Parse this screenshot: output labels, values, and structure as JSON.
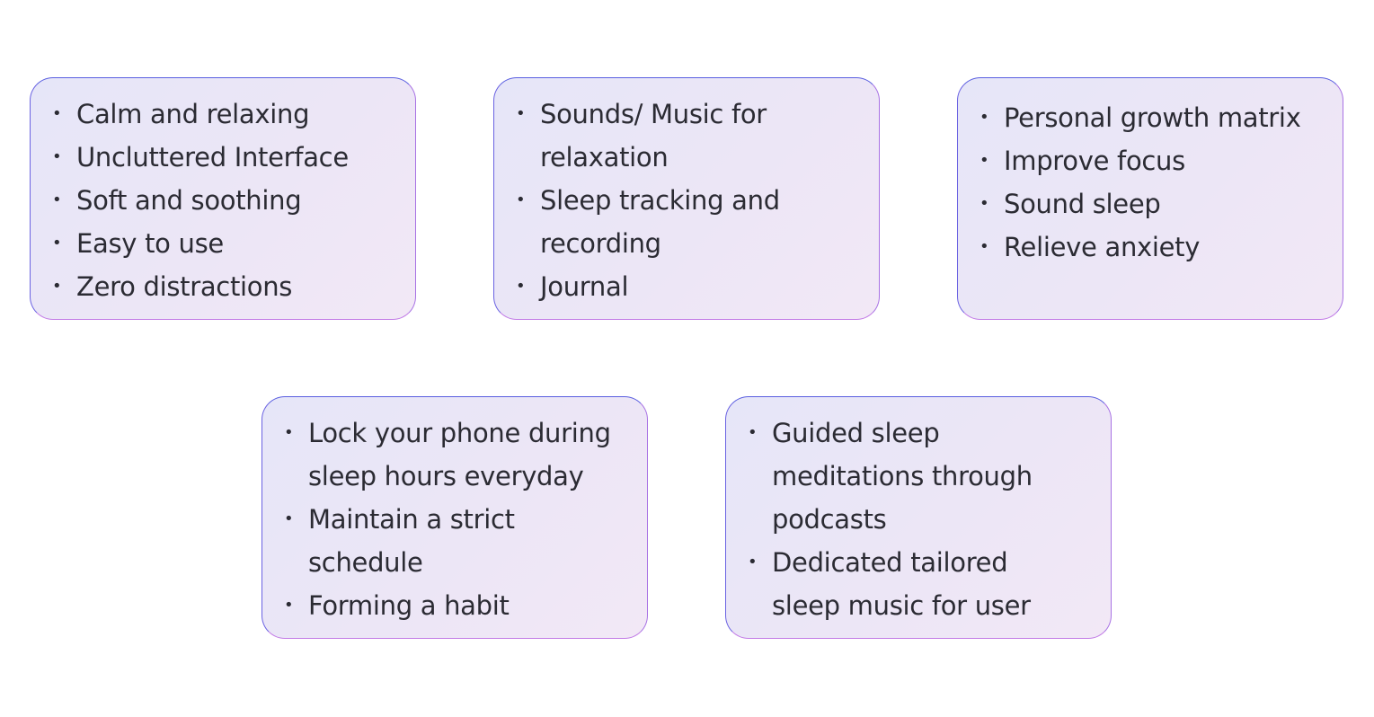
{
  "cards": [
    {
      "items": [
        {
          "lines": [
            "Calm and relaxing"
          ]
        },
        {
          "lines": [
            "Uncluttered Interface"
          ]
        },
        {
          "lines": [
            "Soft and soothing"
          ]
        },
        {
          "lines": [
            "Easy to use"
          ]
        },
        {
          "lines": [
            "Zero distractions"
          ]
        }
      ]
    },
    {
      "items": [
        {
          "lines": [
            "Sounds/ Music for",
            "relaxation"
          ]
        },
        {
          "lines": [
            "Sleep tracking and",
            "recording"
          ]
        },
        {
          "lines": [
            "Journal"
          ]
        }
      ]
    },
    {
      "items": [
        {
          "lines": [
            "Personal growth matrix"
          ]
        },
        {
          "lines": [
            "Improve focus"
          ]
        },
        {
          "lines": [
            "Sound sleep"
          ]
        },
        {
          "lines": [
            "Relieve anxiety"
          ]
        }
      ]
    },
    {
      "items": [
        {
          "lines": [
            "Lock your phone during",
            "sleep hours everyday"
          ]
        },
        {
          "lines": [
            "Maintain a strict",
            "schedule"
          ]
        },
        {
          "lines": [
            "Forming a habit"
          ]
        }
      ]
    },
    {
      "items": [
        {
          "lines": [
            "Guided sleep",
            "meditations through",
            "podcasts"
          ]
        },
        {
          "lines": [
            "Dedicated tailored",
            "sleep music for user"
          ]
        }
      ]
    }
  ],
  "bullet_glyph": "•",
  "colors": {
    "text": "#2b2b33",
    "border_start": "#5a5fe0",
    "border_end": "#c27be6",
    "fill_start": "#e6e6f8",
    "fill_end": "#f2e8f6"
  }
}
